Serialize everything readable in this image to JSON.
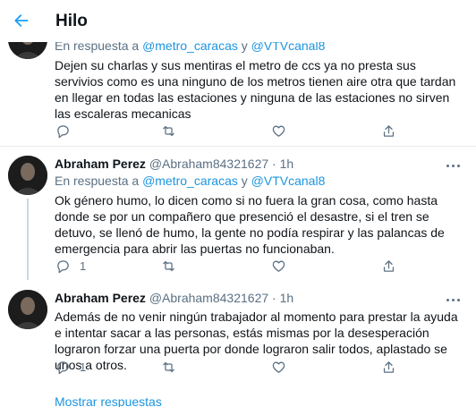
{
  "header": {
    "back_icon": "arrow-left-icon",
    "title": "Hilo",
    "accent": "#1da1f2"
  },
  "tweets": [
    {
      "reply_prefix": "En respuesta a",
      "mention1": "@metro_caracas",
      "conj": "y",
      "mention2": "@VTVcanal8",
      "text": "Dejen su charlas y sus mentiras el metro de ccs ya no presta sus servivios como es una ninguno de los metros tienen aire otra que tardan en llegar en todas las estaciones y ninguna de las estaciones no sirven las escaleras mecanicas"
    },
    {
      "name": "Abraham Perez",
      "handle": "@Abraham84321627",
      "dot": "·",
      "time": "1h",
      "reply_prefix": "En respuesta a",
      "mention1": "@metro_caracas",
      "conj": "y",
      "mention2": "@VTVcanal8",
      "text": "Ok género humo, lo dicen como si no fuera la gran cosa, como hasta donde se por un compañero que presenció el desastre, si el tren se detuvo, se llenó de humo, la gente no podía respirar y las palancas de emergencia para abrir las puertas no funcionaban.",
      "reply_count": "1"
    },
    {
      "name": "Abraham Perez",
      "handle": "@Abraham84321627",
      "dot": "·",
      "time": "1h",
      "text": "Además de no venir ningún trabajador al momento para prestar la ayuda e intentar sacar a las personas, estás mismas por la desesperación lograron forzar una puerta por donde lograron salir todos, aplastado se unos a otros.",
      "reply_count": "1"
    }
  ],
  "show_replies": "Mostrar respuestas",
  "colors": {
    "link": "#1b95e0",
    "secondary_text": "#5b7083",
    "divider": "#e6ecf0"
  }
}
